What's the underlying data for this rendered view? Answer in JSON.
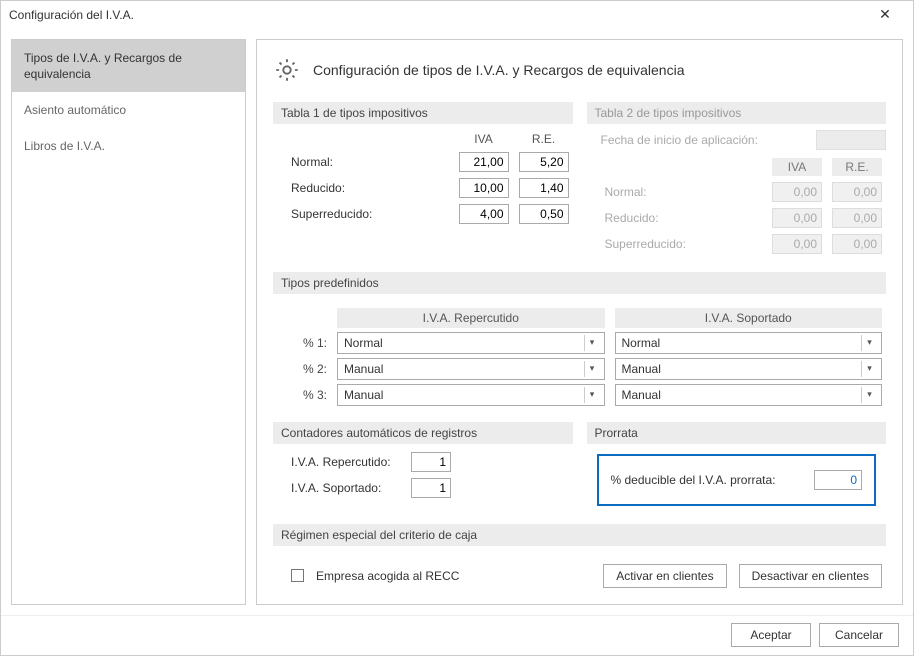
{
  "window": {
    "title": "Configuración del I.V.A."
  },
  "sidebar": {
    "items": [
      {
        "label": "Tipos de I.V.A. y Recargos de equivalencia",
        "active": true
      },
      {
        "label": "Asiento automático",
        "active": false
      },
      {
        "label": "Libros de I.V.A.",
        "active": false
      }
    ]
  },
  "content": {
    "title": "Configuración de tipos de I.V.A. y Recargos de equivalencia",
    "tabla1": {
      "label": "Tabla 1 de tipos impositivos",
      "headers": {
        "iva": "IVA",
        "re": "R.E."
      },
      "rows": {
        "normal": {
          "label": "Normal:",
          "iva": "21,00",
          "re": "5,20"
        },
        "reducido": {
          "label": "Reducido:",
          "iva": "10,00",
          "re": "1,40"
        },
        "super": {
          "label": "Superreducido:",
          "iva": "4,00",
          "re": "0,50"
        }
      }
    },
    "tabla2": {
      "label": "Tabla 2 de tipos impositivos",
      "date_label": "Fecha de inicio de aplicación:",
      "headers": {
        "iva": "IVA",
        "re": "R.E."
      },
      "rows": {
        "normal": {
          "label": "Normal:",
          "iva": "0,00",
          "re": "0,00"
        },
        "reducido": {
          "label": "Reducido:",
          "iva": "0,00",
          "re": "0,00"
        },
        "super": {
          "label": "Superreducido:",
          "iva": "0,00",
          "re": "0,00"
        }
      }
    },
    "predef": {
      "label": "Tipos predefinidos",
      "col_repercutido": "I.V.A. Repercutido",
      "col_soportado": "I.V.A. Soportado",
      "rows": [
        {
          "label": "% 1:",
          "rep": "Normal",
          "sop": "Normal"
        },
        {
          "label": "% 2:",
          "rep": "Manual",
          "sop": "Manual"
        },
        {
          "label": "% 3:",
          "rep": "Manual",
          "sop": "Manual"
        }
      ]
    },
    "counters": {
      "label": "Contadores automáticos de registros",
      "rows": {
        "rep": {
          "label": "I.V.A. Repercutido:",
          "value": "1"
        },
        "sop": {
          "label": "I.V.A. Soportado:",
          "value": "1"
        }
      }
    },
    "prorrata": {
      "label": "Prorrata",
      "field_label": "% deducible del I.V.A. prorrata:",
      "value": "0"
    },
    "recc": {
      "label": "Régimen especial del criterio de caja",
      "checkbox_label": "Empresa acogida al RECC",
      "btn_activar": "Activar en clientes",
      "btn_desactivar": "Desactivar en clientes"
    }
  },
  "footer": {
    "accept": "Aceptar",
    "cancel": "Cancelar"
  }
}
